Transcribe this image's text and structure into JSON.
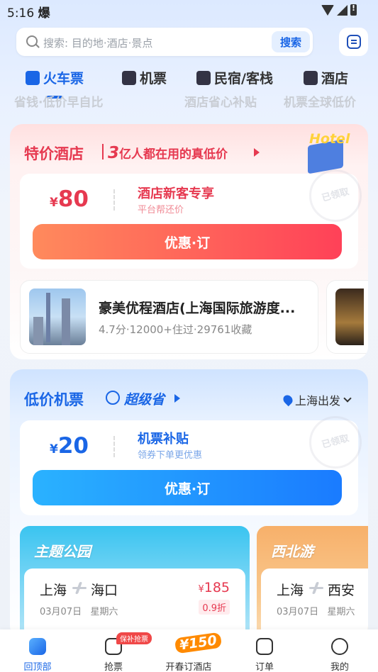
{
  "status_bar": {
    "time": "5:16",
    "extra": "爆"
  },
  "search": {
    "placeholder": "搜索: 目的地·酒店·景点",
    "button_label": "搜索"
  },
  "tabs": [
    {
      "label": "火车票",
      "icon": "train-icon",
      "active": true
    },
    {
      "label": "机票",
      "icon": "plane-icon",
      "active": false
    },
    {
      "label": "民宿/客栈",
      "icon": "house-icon",
      "active": false
    },
    {
      "label": "酒店",
      "icon": "hotel-icon",
      "active": false
    }
  ],
  "partial_row": {
    "left": "省钱·低价早自比",
    "mid": "酒店省心补贴",
    "right": "机票全球低价"
  },
  "hotel_section": {
    "title": "特价酒店",
    "slogan_num": "3",
    "slogan": "亿人都在用的真低价",
    "badge_label": "Hotel",
    "coupon": {
      "currency": "¥",
      "amount": "80",
      "title": "酒店新客专享",
      "subtitle": "平台帮还价",
      "stamp": "已领取"
    },
    "cta_label": "优惠·订",
    "items": [
      {
        "name": "豪美优程酒店(上海国际旅游度...",
        "meta": "4.7分·12000+住过·29761收藏"
      }
    ]
  },
  "flight_section": {
    "title": "低价机票",
    "badge": "超级省",
    "depart_label": "上海出发",
    "coupon": {
      "currency": "¥",
      "amount": "20",
      "title": "机票补贴",
      "subtitle": "领券下单更优惠",
      "stamp": "已领取"
    },
    "cta_label": "优惠·订",
    "promos": [
      {
        "title": "主题公园",
        "from": "上海",
        "to": "海口",
        "date": "03月07日",
        "weekday": "星期六",
        "currency": "¥",
        "price": "185",
        "discount": "0.9折"
      },
      {
        "title": "西北游",
        "from": "上海",
        "to": "西安",
        "date": "03月07日",
        "weekday": "星期六"
      }
    ]
  },
  "bottom_nav": [
    {
      "label": "回顶部",
      "active": true
    },
    {
      "label": "抢票",
      "tag": "保补抢票"
    },
    {
      "label": "开春订酒店",
      "badge": "¥150"
    },
    {
      "label": "订单"
    },
    {
      "label": "我的"
    }
  ],
  "colors": {
    "accent": "#1a66e6",
    "hotel_red": "#e63950",
    "cta_red_start": "#ff8a5c",
    "cta_red_end": "#ff4158",
    "cta_blue_start": "#2ab2ff",
    "cta_blue_end": "#1a7bff"
  }
}
